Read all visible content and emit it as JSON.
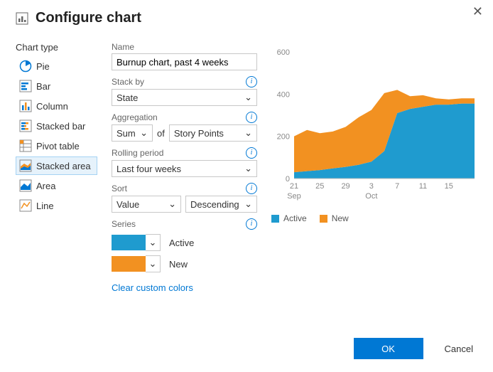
{
  "title": "Configure chart",
  "chart_types_label": "Chart type",
  "chart_types": [
    {
      "id": "pie",
      "label": "Pie"
    },
    {
      "id": "bar",
      "label": "Bar"
    },
    {
      "id": "column",
      "label": "Column"
    },
    {
      "id": "stacked-bar",
      "label": "Stacked bar"
    },
    {
      "id": "pivot-table",
      "label": "Pivot table"
    },
    {
      "id": "stacked-area",
      "label": "Stacked area"
    },
    {
      "id": "area",
      "label": "Area"
    },
    {
      "id": "line",
      "label": "Line"
    }
  ],
  "selected_type": "stacked-area",
  "form": {
    "name_label": "Name",
    "name_value": "Burnup chart, past 4 weeks",
    "stack_by_label": "Stack by",
    "stack_by_value": "State",
    "aggregation_label": "Aggregation",
    "aggregation_func": "Sum",
    "aggregation_of": "of",
    "aggregation_field": "Story Points",
    "rolling_label": "Rolling period",
    "rolling_value": "Last four weeks",
    "sort_label": "Sort",
    "sort_by": "Value",
    "sort_dir": "Descending",
    "series_label": "Series",
    "series": [
      {
        "color": "#1f9bcf",
        "label": "Active"
      },
      {
        "color": "#f29121",
        "label": "New"
      }
    ],
    "clear_colors": "Clear custom colors"
  },
  "buttons": {
    "ok": "OK",
    "cancel": "Cancel"
  },
  "colors": {
    "active": "#1f9bcf",
    "new": "#f29121"
  },
  "chart_data": {
    "type": "area",
    "title": "",
    "xlabel": "",
    "ylabel": "",
    "ylim": [
      0,
      600
    ],
    "yticks": [
      0,
      200,
      400,
      600
    ],
    "x": [
      "21",
      "23",
      "25",
      "27",
      "29",
      "1",
      "3",
      "5",
      "7",
      "9",
      "11",
      "13",
      "15",
      "17",
      "19"
    ],
    "x_ticks": [
      "21",
      "25",
      "29",
      "3",
      "7",
      "11",
      "15"
    ],
    "x_months": {
      "Sep": "21",
      "Oct": "3"
    },
    "series": [
      {
        "name": "Active",
        "color": "#1f9bcf",
        "values": [
          30,
          35,
          40,
          48,
          55,
          65,
          80,
          130,
          310,
          330,
          340,
          350,
          350,
          355,
          355
        ]
      },
      {
        "name": "New",
        "color": "#f29121",
        "values": [
          170,
          195,
          175,
          175,
          190,
          225,
          245,
          275,
          110,
          60,
          55,
          30,
          25,
          25,
          25
        ]
      }
    ],
    "legend": [
      "Active",
      "New"
    ]
  }
}
